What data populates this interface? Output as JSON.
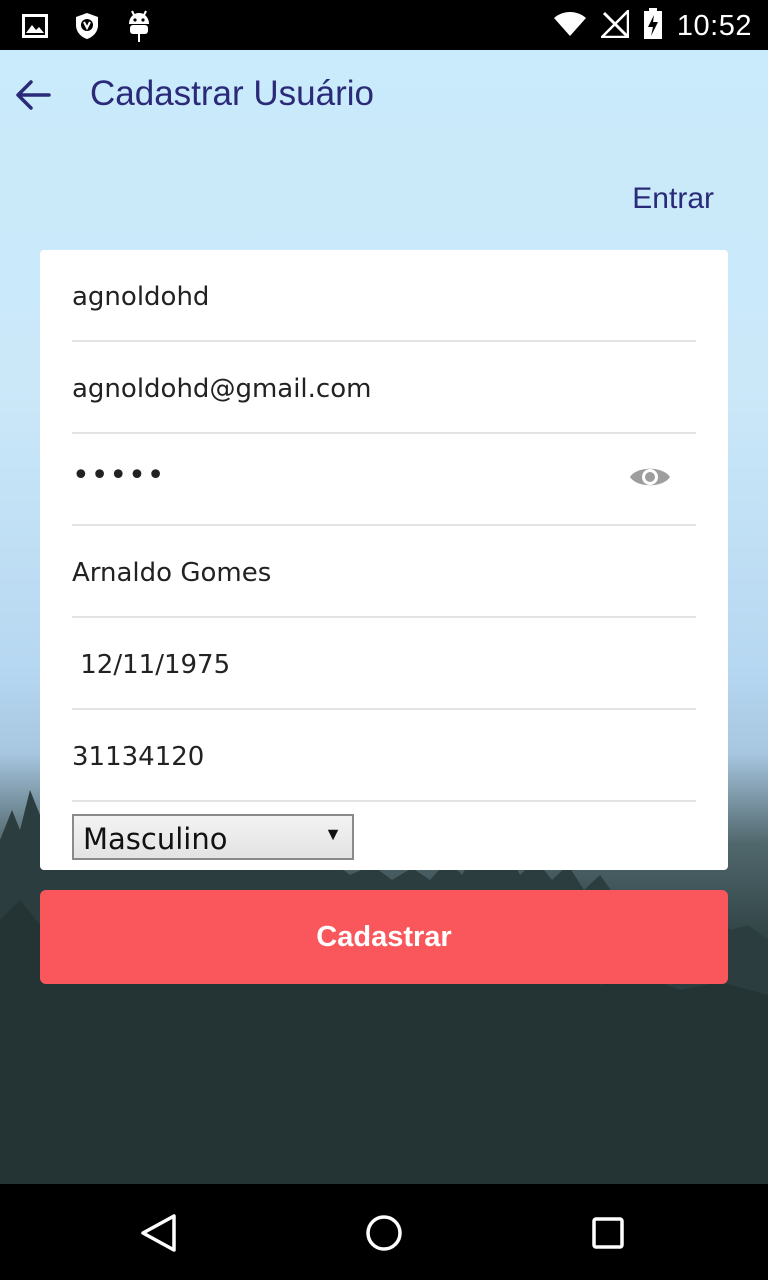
{
  "status_bar": {
    "time": "10:52",
    "icons": [
      "image-icon",
      "vpn-shield-icon",
      "android-icon",
      "wifi-icon",
      "no-signal-icon",
      "battery-charging-icon"
    ]
  },
  "toolbar": {
    "title": "Cadastrar Usuário",
    "back_icon": "arrow-back-icon"
  },
  "login_link": "Entrar",
  "form": {
    "username": "agnoldohd",
    "email": "agnoldohd@gmail.com",
    "password_masked": "•••••",
    "password_toggle_icon": "eye-icon",
    "full_name": "Arnaldo Gomes",
    "birth_date": " 12/11/1975",
    "phone": "31134120",
    "gender": "Masculino"
  },
  "submit_label": "Cadastrar",
  "colors": {
    "accent": "#fa575c",
    "title": "#2a2a78"
  },
  "nav_bar": {
    "icons": [
      "back-triangle-icon",
      "home-circle-icon",
      "recents-square-icon"
    ]
  }
}
